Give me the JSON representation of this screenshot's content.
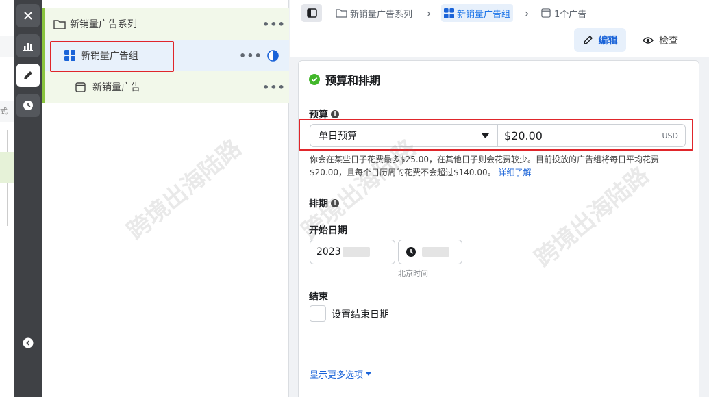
{
  "backdrop": {
    "partial_text": "式"
  },
  "tree": {
    "campaign": {
      "label": "新销量广告系列",
      "more": "•••"
    },
    "adset": {
      "label": "新销量广告组",
      "more": "•••"
    },
    "ad": {
      "label": "新销量广告",
      "more": "•••"
    }
  },
  "breadcrumb": {
    "campaign": "新销量广告系列",
    "separator": "›",
    "adset": "新销量广告组",
    "ad": "1个广告"
  },
  "toolbar": {
    "edit_label": "编辑",
    "view_label": "检查"
  },
  "budget_schedule": {
    "section_title": "预算和排期",
    "budget_label": "预算",
    "budget_type": "单日预算",
    "budget_amount": "$20.00",
    "currency": "USD",
    "help_text": "你会在某些日子花费最多$25.00，在其他日子则会花费较少。目前投放的广告组将每日平均花费$20.00，且每个日历周的花费不会超过$140.00。",
    "learn_more": "详细了解",
    "schedule_label": "排期",
    "start_date_label": "开始日期",
    "start_date_value": "2023",
    "timezone": "北京时间",
    "end_label": "结束",
    "set_end_date": "设置结束日期",
    "show_more": "显示更多选项"
  },
  "watermark": "跨境出海陆路",
  "colors": {
    "accent": "#1a63d8",
    "success": "#42b72a",
    "highlight": "#e0262b"
  }
}
